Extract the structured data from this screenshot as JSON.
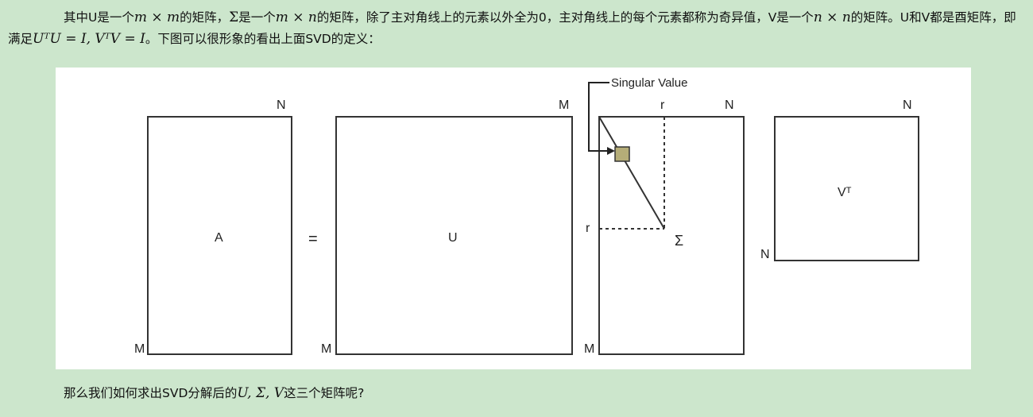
{
  "paragraph1": {
    "t1": "其中U是一个",
    "m1": "m × m",
    "t2": "的矩阵，",
    "m2": "Σ",
    "t3": "是一个",
    "m3": "m × n",
    "t4": "的矩阵，除了主对角线上的元素以外全为0，主对角线上的每个元素都称为奇异值，V是一个",
    "m4": "n × n",
    "t5": "的矩阵。U和V都是酉矩阵，即满足",
    "m5": "UᵀU = I, VᵀV = I",
    "t6": "。下图可以很形象的看出上面SVD的定义："
  },
  "figure": {
    "singular_value_label": "Singular Value",
    "matrix_a": {
      "label": "A",
      "top_right": "N",
      "bottom_left": "M"
    },
    "equals": "=",
    "matrix_u": {
      "label": "U",
      "top_right": "M",
      "bottom_left": "M"
    },
    "matrix_sigma": {
      "label": "Σ",
      "top_r": "r",
      "top_right": "N",
      "side_r": "r",
      "bottom_left": "M"
    },
    "matrix_vt": {
      "label": "Vᵀ",
      "top_right": "N",
      "bottom_left": "N"
    },
    "colors": {
      "singular_box": "#b5ad78"
    }
  },
  "paragraph2": {
    "t1": "那么我们如何求出SVD分解后的",
    "m1": "U, Σ, V",
    "t2": "这三个矩阵呢?"
  }
}
